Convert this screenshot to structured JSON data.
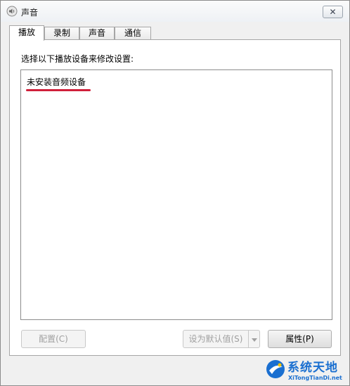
{
  "window": {
    "title": "声音",
    "close_glyph": "✕",
    "icon": "speaker-icon"
  },
  "tabs": [
    {
      "label": "播放",
      "active": true
    },
    {
      "label": "录制",
      "active": false
    },
    {
      "label": "声音",
      "active": false
    },
    {
      "label": "通信",
      "active": false
    }
  ],
  "playback": {
    "instruction": "选择以下播放设备来修改设置:",
    "empty_message": "未安装音频设备"
  },
  "buttons": {
    "configure": "配置(C)",
    "set_default": "设为默认值(S)",
    "properties": "属性(P)"
  },
  "watermark": {
    "title": "系统天地",
    "subtitle": "XiTongTianDi.net"
  },
  "colors": {
    "accent_underline": "#d0203a",
    "watermark_blue": "#1a6fd0"
  }
}
